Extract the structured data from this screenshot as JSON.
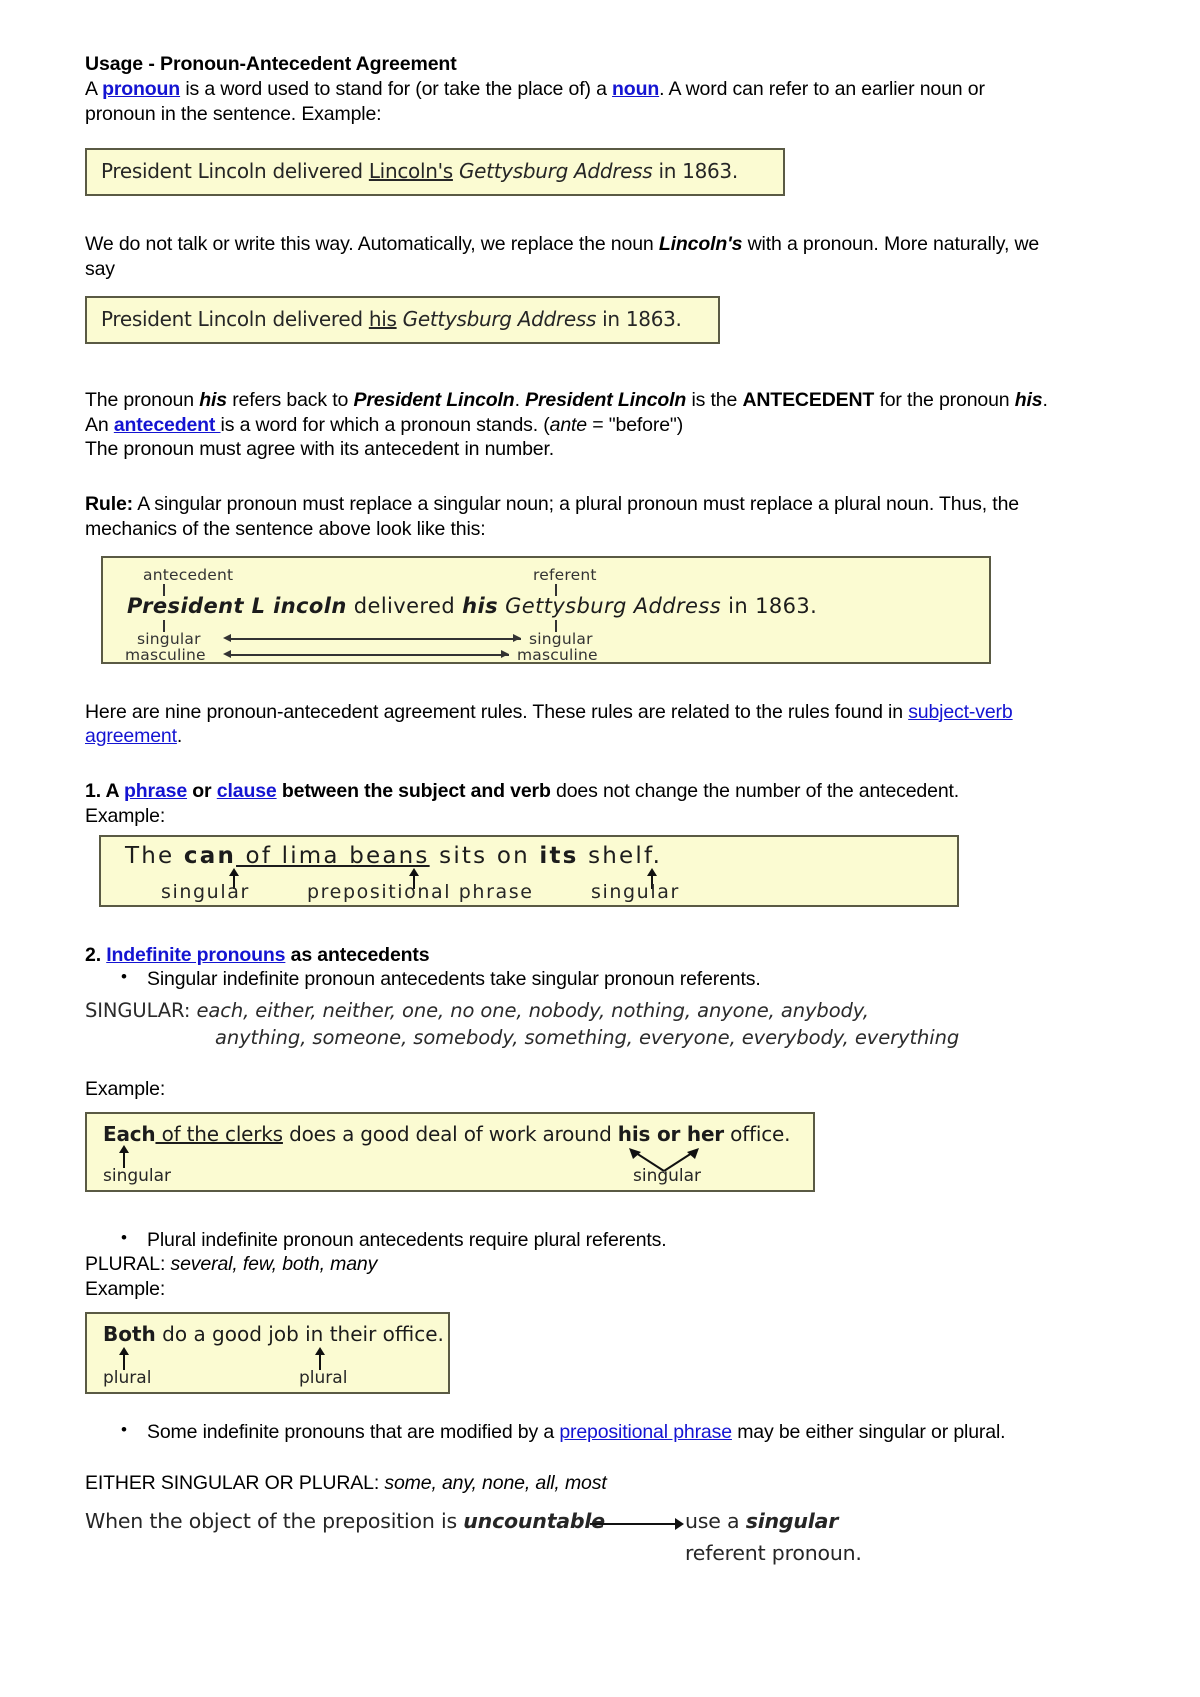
{
  "document": {
    "title": "Usage - Pronoun-Antecedent Agreement",
    "intro": {
      "part1": "A ",
      "link_pronoun": "pronoun",
      "part2": " is a word used to stand for (or take the place of) a ",
      "link_noun": "noun",
      "part3": ".    A word can refer to an earlier noun or pronoun in the sentence.    Example:"
    },
    "example_box_1": {
      "before": "President Lincoln delivered ",
      "underlined": "Lincoln's",
      "italic": " Gettysburg Address",
      "after": " in 1863."
    },
    "para_replace": {
      "part1": "We do not talk or write this way. Automatically, we replace the noun ",
      "bold_italic": "Lincoln's",
      "part2": " with a pronoun. More naturally, we say"
    },
    "example_box_2": {
      "before": "President Lincoln delivered ",
      "underlined": "his",
      "italic": " Gettysburg Address",
      "after": " in 1863."
    },
    "para_antecedent": {
      "l1_a": "The pronoun ",
      "l1_his": "his",
      "l1_b": " refers back to ",
      "l1_pl1": "President Lincoln",
      "l1_c": ". ",
      "l1_pl2": "President Lincoln",
      "l1_d": " is the ",
      "l1_ante": "ANTECEDENT",
      "l1_e": " for the pronoun ",
      "l1_his2": "his",
      "l1_f": ".     An ",
      "link_antecedent": "antecedent ",
      "l1_g": "is a word for which a pronoun stands. (",
      "l1_ante_it": "ante",
      "l1_h": " = \"before\")",
      "l2": "The pronoun must agree with its antecedent in number."
    },
    "rule": {
      "label": "Rule:",
      "text": " A singular pronoun must replace a singular noun; a plural pronoun must replace a plural noun. Thus, the mechanics of the sentence above look like this:"
    },
    "lincoln_diagram": {
      "label_antecedent": "antecedent",
      "label_referent": "referent",
      "sentence_bold": "President L incoln",
      "sentence_mid": " delivered ",
      "sentence_his": "his",
      "sentence_title": " Gettysburg Address",
      "sentence_end": " in 1863.",
      "left_singular": "singular",
      "left_masculine": "masculine",
      "right_singular": "singular",
      "right_masculine": "masculine"
    },
    "nine_rules": {
      "part1": "Here are nine pronoun-antecedent agreement rules. These rules are related to the rules found in ",
      "link": "subject-verb agreement",
      "part2": "."
    },
    "rule1": {
      "num": "1. A ",
      "link_phrase": "phrase",
      "or": " or ",
      "link_clause": "clause",
      "bold_tail": " between the subject and verb",
      "rest": " does not change the number of the antecedent.",
      "example_label": "Example:"
    },
    "lima_box": {
      "w1": "The ",
      "w2_bold": "can",
      "w3_underline": " of lima beans",
      "w4": " sits on ",
      "w5_bold": "its",
      "w6": " shelf.",
      "sub1": "singular",
      "sub2": "prepositional phrase",
      "sub3": "singular"
    },
    "rule2": {
      "num": "2. ",
      "link": "Indefinite pronouns",
      "rest": " as antecedents",
      "bullet1": "Singular indefinite pronoun antecedents take singular pronoun referents."
    },
    "singular_list": {
      "lead": "SINGULAR: ",
      "row1": "each, either, neither, one, no one, nobody, nothing, anyone, anybody,",
      "row2": "anything, someone, somebody, something, everyone, everybody, everything"
    },
    "example_label_2": "Example:",
    "each_box": {
      "w1_bold": "Each",
      "w2_underline": " of the clerks",
      "w3": " does a good deal of work around ",
      "w4_bold": "his or her",
      "w5": " office.",
      "sub_left": "singular",
      "sub_right": "singular"
    },
    "plural_section": {
      "bullet": "Plural indefinite pronoun antecedents require plural referents.",
      "label": "PLURAL: ",
      "items": "several, few, both, many",
      "example_label": "Example:"
    },
    "both_box": {
      "w1_bold": "Both",
      "w2": " do a good job in their office.",
      "sub_left": "plural",
      "sub_right": "plural"
    },
    "some_bullet": {
      "part1": "Some indefinite pronouns that are modified by a ",
      "link": "prepositional phrase",
      "part2": " may be either singular or plural."
    },
    "either_line": {
      "label": "EITHER SINGULAR OR PLURAL: ",
      "items": "some, any, none, all, most"
    },
    "uncountable": {
      "line1_a": "When the object of the preposition is ",
      "line1_b": "uncountable",
      "line2_a": "use a ",
      "line2_b": "singular",
      "line3": "referent pronoun."
    }
  },
  "colors": {
    "link": "#1414d2",
    "box_fill": "#fbfbd2",
    "box_border": "#5a5a44",
    "text": "#000000"
  }
}
